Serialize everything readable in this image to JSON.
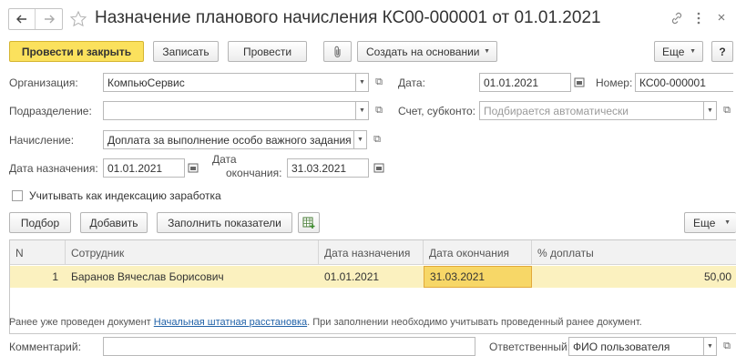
{
  "window": {
    "title": "Назначение планового начисления КС00-000001 от 01.01.2021",
    "back_icon": "arrow-left-icon",
    "forward_icon": "arrow-right-icon",
    "star_icon": "star-outline-icon",
    "link_icon": "link-icon",
    "more_icon": "vertical-dots-icon",
    "close_icon": "close-icon"
  },
  "toolbar": {
    "post_close": "Провести и закрыть",
    "save": "Записать",
    "post": "Провести",
    "attach_icon": "paperclip-icon",
    "create_based": "Создать на основании",
    "more": "Еще",
    "help": "?"
  },
  "form": {
    "org_label": "Организация:",
    "org_value": "КомпьюСервис",
    "date_label": "Дата:",
    "date_value": "01.01.2021",
    "number_label": "Номер:",
    "number_value": "КС00-000001",
    "dept_label": "Подразделение:",
    "dept_value": "",
    "account_label": "Счет, субконто:",
    "account_placeholder": "Подбирается автоматически",
    "accrual_label": "Начисление:",
    "accrual_value": "Доплата за выполнение особо важного задания",
    "assign_date_label": "Дата назначения:",
    "assign_date_value": "01.01.2021",
    "end_date_label_1": "Дата",
    "end_date_label_2": "окончания:",
    "end_date_value": "31.03.2021",
    "indexation_label": "Учитывать как индексацию заработка",
    "indexation_checked": false
  },
  "table_toolbar": {
    "select": "Подбор",
    "add": "Добавить",
    "fill": "Заполнить показатели",
    "grid_icon": "table-settings-icon",
    "more": "Еще"
  },
  "table": {
    "columns": [
      "N",
      "Сотрудник",
      "Дата назначения",
      "Дата окончания",
      "% доплаты"
    ],
    "rows": [
      {
        "n": "1",
        "employee": "Баранов Вячеслав Борисович",
        "start": "01.01.2021",
        "end": "31.03.2021",
        "percent": "50,00"
      }
    ]
  },
  "info": {
    "prefix": "Ранее уже проведен документ ",
    "link": "Начальная штатная расстановка",
    "suffix": ". При заполнении необходимо учитывать проведенный ранее документ."
  },
  "footer": {
    "comment_label": "Комментарий:",
    "comment_value": "",
    "responsible_label": "Ответственный:",
    "responsible_value": "ФИО пользователя"
  }
}
